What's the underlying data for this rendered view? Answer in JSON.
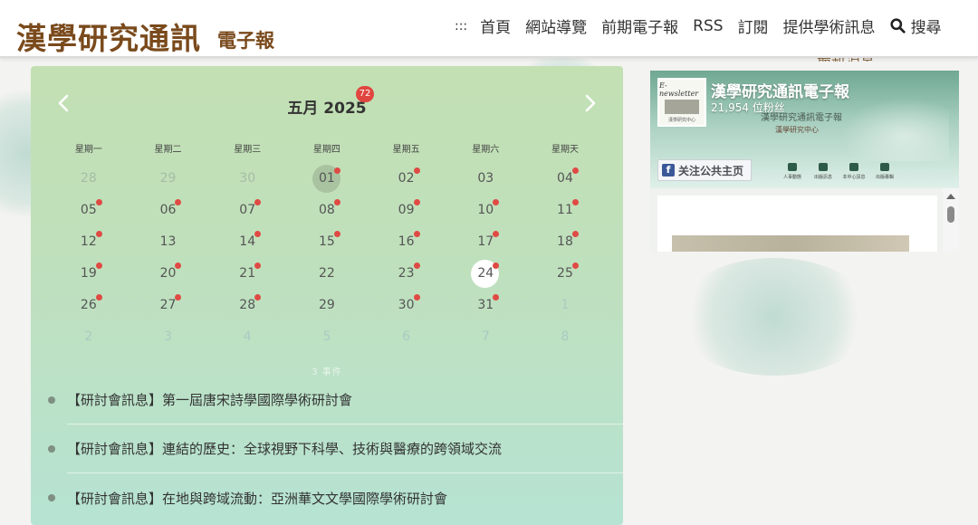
{
  "header": {
    "logo_main": "漢學研究通訊",
    "logo_sub": "電子報",
    "nav": [
      {
        "label": ":::"
      },
      {
        "label": "首頁"
      },
      {
        "label": "網站導覽"
      },
      {
        "label": "前期電子報"
      },
      {
        "label": "RSS"
      },
      {
        "label": "訂閱"
      },
      {
        "label": "提供學術訊息"
      }
    ],
    "search_label": "搜尋",
    "search_icon": "search-icon"
  },
  "calendar": {
    "title": "五月 2025",
    "badge": "72",
    "prev_icon": "chevron-left-icon",
    "next_icon": "chevron-right-icon",
    "weekdays": [
      "星期一",
      "星期二",
      "星期三",
      "星期四",
      "星期五",
      "星期六",
      "星期天"
    ],
    "weeks": [
      [
        {
          "d": "28",
          "s": "muted"
        },
        {
          "d": "29",
          "s": "muted"
        },
        {
          "d": "30",
          "s": "muted"
        },
        {
          "d": "01",
          "dot": true,
          "s": "active"
        },
        {
          "d": "02",
          "dot": true
        },
        {
          "d": "03"
        },
        {
          "d": "04",
          "dot": true
        }
      ],
      [
        {
          "d": "05",
          "dot": true
        },
        {
          "d": "06",
          "dot": true
        },
        {
          "d": "07",
          "dot": true
        },
        {
          "d": "08",
          "dot": true
        },
        {
          "d": "09",
          "dot": true
        },
        {
          "d": "10",
          "dot": true
        },
        {
          "d": "11",
          "dot": true
        }
      ],
      [
        {
          "d": "12",
          "dot": true
        },
        {
          "d": "13"
        },
        {
          "d": "14",
          "dot": true
        },
        {
          "d": "15",
          "dot": true
        },
        {
          "d": "16",
          "dot": true
        },
        {
          "d": "17",
          "dot": true
        },
        {
          "d": "18",
          "dot": true
        }
      ],
      [
        {
          "d": "19",
          "dot": true
        },
        {
          "d": "20",
          "dot": true
        },
        {
          "d": "21",
          "dot": true
        },
        {
          "d": "22"
        },
        {
          "d": "23",
          "dot": true
        },
        {
          "d": "24",
          "dot": true,
          "s": "today"
        },
        {
          "d": "25",
          "dot": true
        }
      ],
      [
        {
          "d": "26",
          "dot": true
        },
        {
          "d": "27",
          "dot": true
        },
        {
          "d": "28",
          "dot": true
        },
        {
          "d": "29"
        },
        {
          "d": "30",
          "dot": true
        },
        {
          "d": "31",
          "dot": true
        },
        {
          "d": "1",
          "s": "faded"
        }
      ],
      [
        {
          "d": "2",
          "s": "faded"
        },
        {
          "d": "3",
          "s": "faded"
        },
        {
          "d": "4",
          "s": "faded"
        },
        {
          "d": "5",
          "s": "faded"
        },
        {
          "d": "6",
          "s": "faded"
        },
        {
          "d": "7",
          "s": "faded"
        },
        {
          "d": "8",
          "s": "faded"
        }
      ]
    ],
    "event_count": "3 事件",
    "events": [
      {
        "text": "【研討會訊息】第一屆唐宋詩學國際學術研討會"
      },
      {
        "text": "【研討會訊息】連結的歷史：全球視野下科學、技術與醫療的跨領域交流"
      },
      {
        "text": "【研討會訊息】在地與跨域流動：亞洲華文文學國際學術研討會"
      }
    ]
  },
  "facebook": {
    "page_name": "漢學研究通訊電子報",
    "fans": "21,954 位粉丝",
    "like_button": "关注公共主页",
    "fb_letter": "f",
    "avatar_top": "E-newsletter",
    "avatar_bottom": "漢學研究中心",
    "cover_text": "漢學研究通訊電子報",
    "cover_text2": "漢學研究中心",
    "menu": [
      "人事動態",
      "出版訊息",
      "本中心訊息",
      "出版專輯",
      "其他"
    ]
  },
  "colors": {
    "logo": "#7a4a1c",
    "badge": "#e0463f",
    "event_dot": "#e04a44",
    "facebook_blue": "#3b5998"
  }
}
